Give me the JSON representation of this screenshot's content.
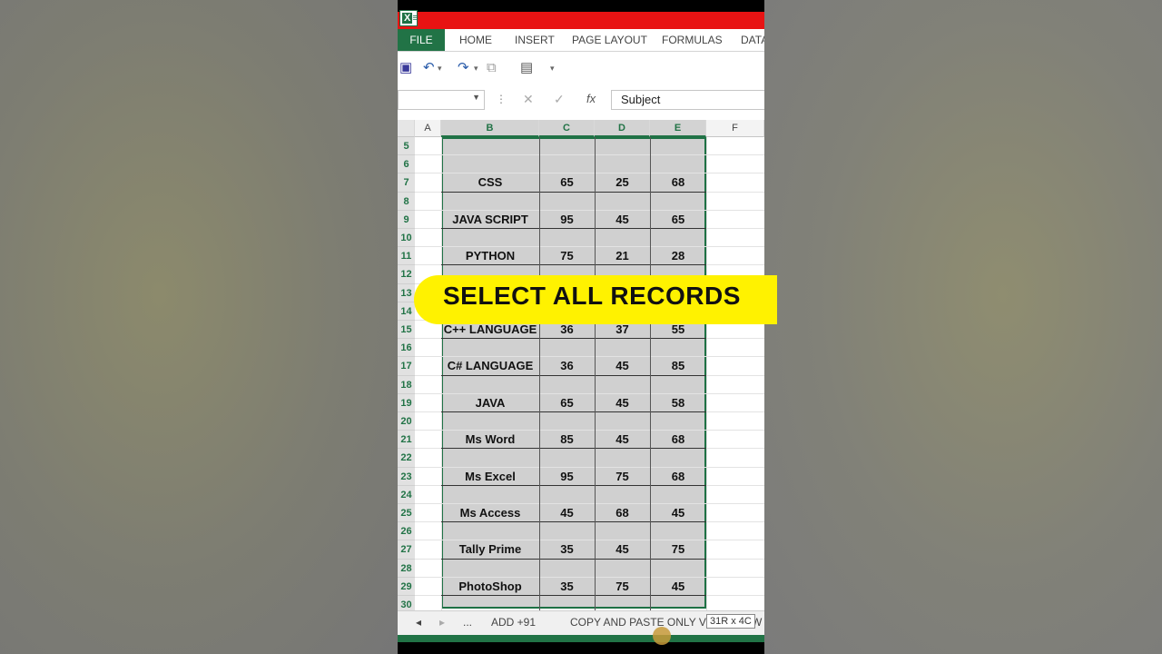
{
  "ribbon": {
    "tabs": [
      "FILE",
      "HOME",
      "INSERT",
      "PAGE LAYOUT",
      "FORMULAS",
      "DATA"
    ]
  },
  "formula_bar": {
    "name_box": "",
    "formula_value": "Subject",
    "fx_label": "fx"
  },
  "columns": [
    "A",
    "B",
    "C",
    "D",
    "E",
    "F"
  ],
  "rows": [
    {
      "n": "5",
      "b": "",
      "c": "",
      "d": "",
      "e": ""
    },
    {
      "n": "6",
      "b": "",
      "c": "",
      "d": "",
      "e": ""
    },
    {
      "n": "7",
      "b": "CSS",
      "c": "65",
      "d": "25",
      "e": "68"
    },
    {
      "n": "8",
      "b": "",
      "c": "",
      "d": "",
      "e": ""
    },
    {
      "n": "9",
      "b": "JAVA SCRIPT",
      "c": "95",
      "d": "45",
      "e": "65"
    },
    {
      "n": "10",
      "b": "",
      "c": "",
      "d": "",
      "e": ""
    },
    {
      "n": "11",
      "b": "PYTHON",
      "c": "75",
      "d": "21",
      "e": "28"
    },
    {
      "n": "12",
      "b": "",
      "c": "",
      "d": "",
      "e": ""
    },
    {
      "n": "13",
      "b": "",
      "c": "",
      "d": "",
      "e": ""
    },
    {
      "n": "14",
      "b": "",
      "c": "",
      "d": "",
      "e": ""
    },
    {
      "n": "15",
      "b": "C++ LANGUAGE",
      "c": "36",
      "d": "37",
      "e": "55"
    },
    {
      "n": "16",
      "b": "",
      "c": "",
      "d": "",
      "e": ""
    },
    {
      "n": "17",
      "b": "C# LANGUAGE",
      "c": "36",
      "d": "45",
      "e": "85"
    },
    {
      "n": "18",
      "b": "",
      "c": "",
      "d": "",
      "e": ""
    },
    {
      "n": "19",
      "b": "JAVA",
      "c": "65",
      "d": "45",
      "e": "58"
    },
    {
      "n": "20",
      "b": "",
      "c": "",
      "d": "",
      "e": ""
    },
    {
      "n": "21",
      "b": "Ms Word",
      "c": "85",
      "d": "45",
      "e": "68"
    },
    {
      "n": "22",
      "b": "",
      "c": "",
      "d": "",
      "e": ""
    },
    {
      "n": "23",
      "b": "Ms Excel",
      "c": "95",
      "d": "75",
      "e": "68"
    },
    {
      "n": "24",
      "b": "",
      "c": "",
      "d": "",
      "e": ""
    },
    {
      "n": "25",
      "b": "Ms Access",
      "c": "45",
      "d": "68",
      "e": "45"
    },
    {
      "n": "26",
      "b": "",
      "c": "",
      "d": "",
      "e": ""
    },
    {
      "n": "27",
      "b": "Tally Prime",
      "c": "35",
      "d": "45",
      "e": "75"
    },
    {
      "n": "28",
      "b": "",
      "c": "",
      "d": "",
      "e": ""
    },
    {
      "n": "29",
      "b": "PhotoShop",
      "c": "35",
      "d": "75",
      "e": "45"
    },
    {
      "n": "30",
      "b": "",
      "c": "",
      "d": "",
      "e": ""
    }
  ],
  "banner": "SELECT ALL RECORDS",
  "sheet_tabs": {
    "more": "...",
    "tab1": "ADD +91",
    "tab2": "COPY AND PASTE ONLY VIS",
    "tab2_tail": "W"
  },
  "selection_tip": "31R x 4C",
  "colors": {
    "excel_green": "#217346",
    "title_red": "#e81313",
    "banner_yellow": "#fff200"
  }
}
